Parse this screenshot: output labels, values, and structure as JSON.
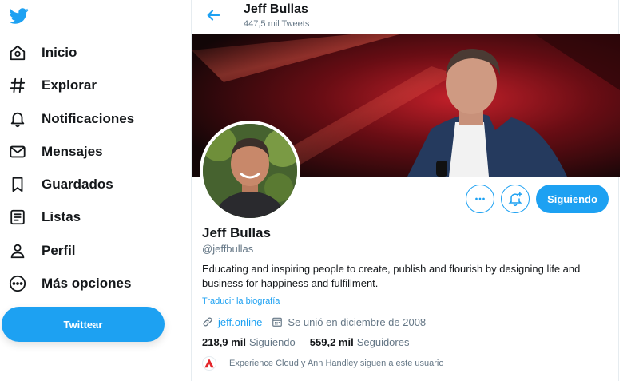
{
  "nav": {
    "items": [
      {
        "label": "Inicio",
        "icon": "home-icon"
      },
      {
        "label": "Explorar",
        "icon": "hashtag-icon"
      },
      {
        "label": "Notificaciones",
        "icon": "bell-icon"
      },
      {
        "label": "Mensajes",
        "icon": "mail-icon"
      },
      {
        "label": "Guardados",
        "icon": "bookmark-icon"
      },
      {
        "label": "Listas",
        "icon": "list-icon"
      },
      {
        "label": "Perfil",
        "icon": "person-icon"
      },
      {
        "label": "Más opciones",
        "icon": "more-circle-icon"
      }
    ],
    "tweet_label": "Twittear"
  },
  "header": {
    "name": "Jeff Bullas",
    "tweet_count": "447,5 mil Tweets"
  },
  "profile": {
    "name": "Jeff Bullas",
    "handle": "@jeffbullas",
    "bio": "Educating and inspiring people to create, publish and flourish by designing life and business for happiness and fulfillment.",
    "translate_label": "Traducir la biografía",
    "website": "jeff.online",
    "joined": "Se unió en diciembre de 2008",
    "following_count": "218,9 mil",
    "following_label": "Siguiendo",
    "followers_count": "559,2 mil",
    "followers_label": "Seguidores",
    "followed_by": "Experience Cloud y Ann Handley siguen a este usuario"
  },
  "actions": {
    "follow_label": "Siguiendo"
  },
  "colors": {
    "accent": "#1da1f2",
    "text": "#14171a",
    "muted": "#657786"
  }
}
